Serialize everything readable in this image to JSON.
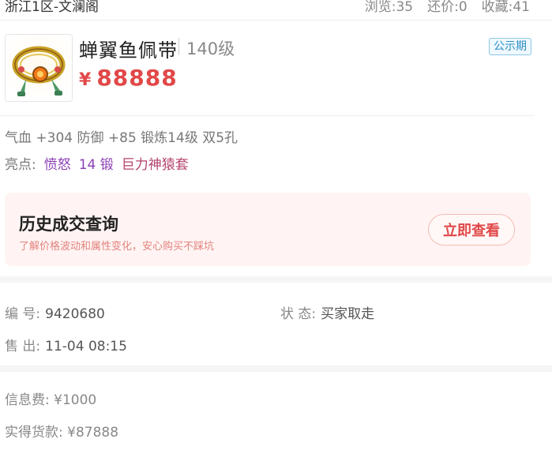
{
  "header": {
    "server": "浙江1区-文澜阁",
    "views": "浏览:35",
    "counter": "还价:0",
    "favorites": "收藏:41"
  },
  "item": {
    "icon": "ornate-belt-icon",
    "name": "蝉翼鱼佩带",
    "level": "140级",
    "currency": "¥",
    "price": "88888",
    "badge": "公示期",
    "attributes": "气血 +304 防御 +85 锻炼14级 双5孔",
    "highlights_label": "亮点:",
    "highlights": [
      "愤怒",
      "14 锻",
      "巨力神猿套"
    ]
  },
  "history": {
    "title": "历史成交查询",
    "subtitle": "了解价格波动和属性变化，安心购买不踩坑",
    "button": "立即查看"
  },
  "details": {
    "id_label": "编 号:",
    "id_value": "9420680",
    "status_label": "状 态:",
    "status_value": "买家取走",
    "sold_label": "售 出:",
    "sold_value": "11-04 08:15"
  },
  "fees": {
    "info_fee": "信息费: ¥1000",
    "net_amount": "实得货款: ¥87888"
  },
  "colors": {
    "price": "#e14848",
    "badge": "#2f8fc6",
    "highlight_purple": "#8c3fb5",
    "highlight_red": "#b5446e",
    "history_bg": "#fff4f3"
  }
}
